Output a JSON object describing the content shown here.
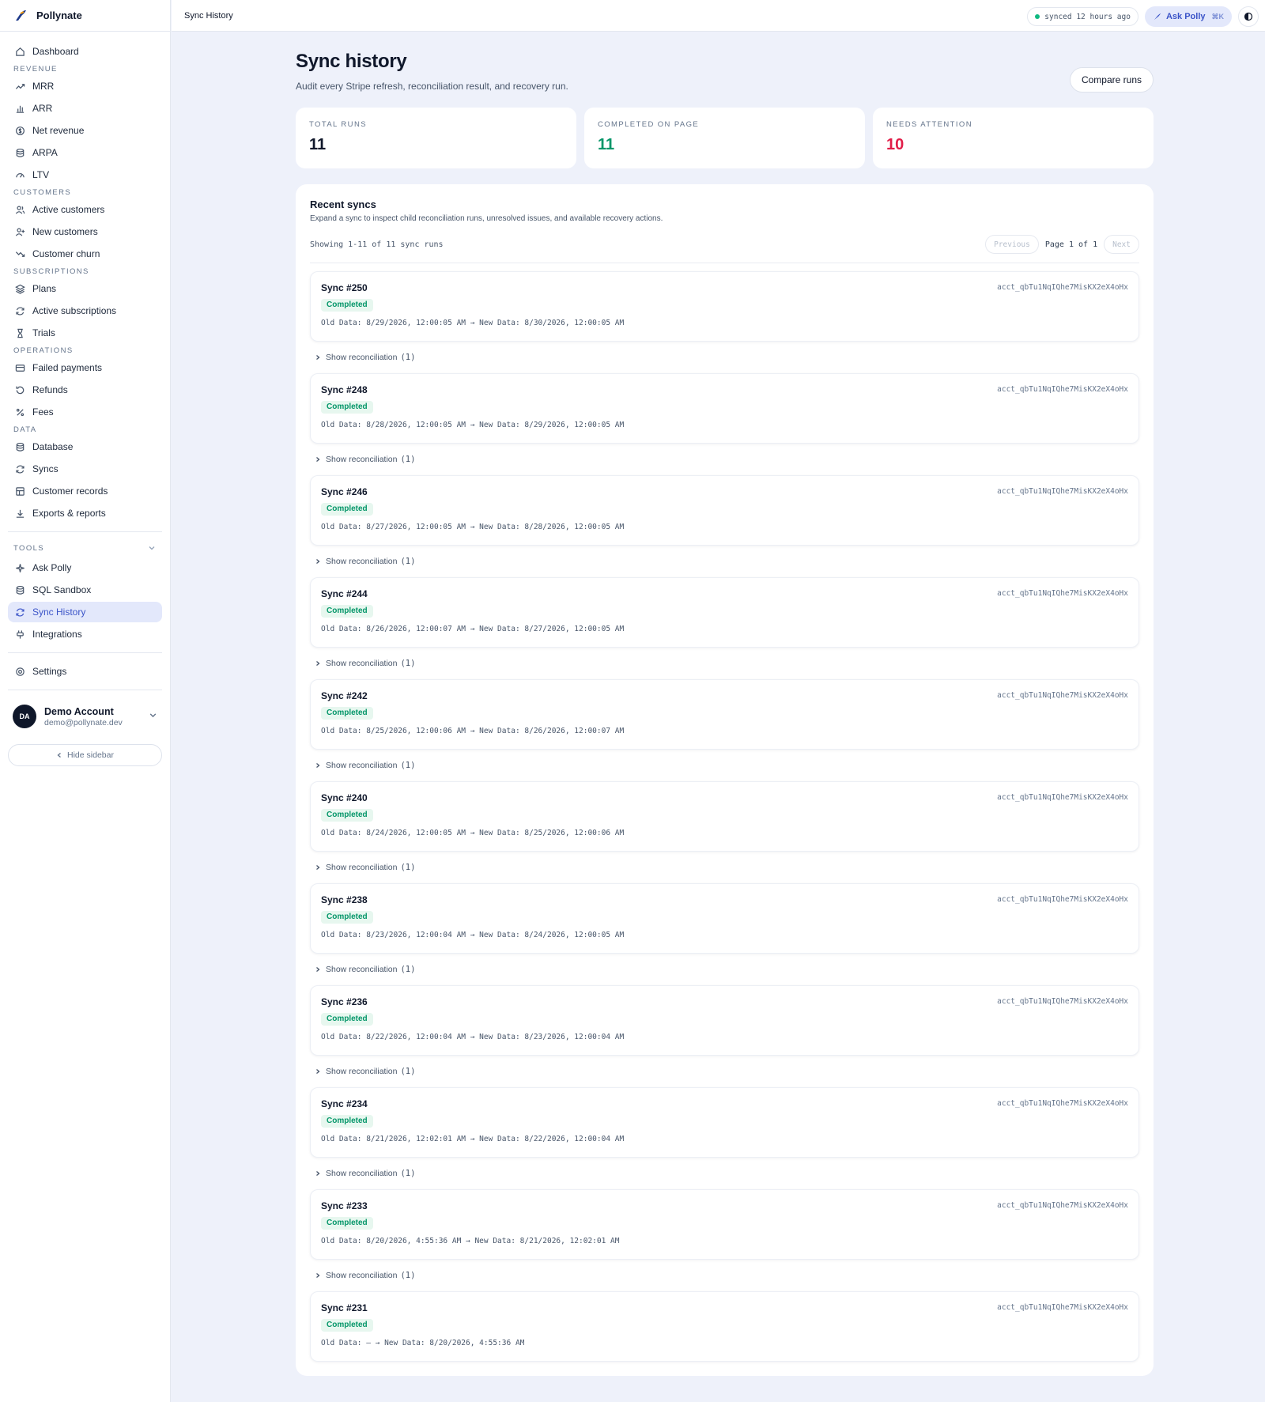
{
  "app": {
    "name": "Pollynate"
  },
  "sidebar": {
    "dashboard": "Dashboard",
    "sections": [
      {
        "label": "REVENUE",
        "items": [
          {
            "label": "MRR",
            "icon": "trend-up-icon"
          },
          {
            "label": "ARR",
            "icon": "bar-chart-icon"
          },
          {
            "label": "Net revenue",
            "icon": "dollar-circle-icon"
          },
          {
            "label": "ARPA",
            "icon": "database-icon"
          },
          {
            "label": "LTV",
            "icon": "gauge-icon"
          }
        ]
      },
      {
        "label": "CUSTOMERS",
        "items": [
          {
            "label": "Active customers",
            "icon": "users-icon"
          },
          {
            "label": "New customers",
            "icon": "user-plus-icon"
          },
          {
            "label": "Customer churn",
            "icon": "trend-down-icon"
          }
        ]
      },
      {
        "label": "SUBSCRIPTIONS",
        "items": [
          {
            "label": "Plans",
            "icon": "layers-icon"
          },
          {
            "label": "Active subscriptions",
            "icon": "refresh-icon"
          },
          {
            "label": "Trials",
            "icon": "hourglass-icon"
          }
        ]
      },
      {
        "label": "OPERATIONS",
        "items": [
          {
            "label": "Failed payments",
            "icon": "credit-card-icon"
          },
          {
            "label": "Refunds",
            "icon": "rotate-ccw-icon"
          },
          {
            "label": "Fees",
            "icon": "percent-icon"
          }
        ]
      },
      {
        "label": "DATA",
        "items": [
          {
            "label": "Database",
            "icon": "database-icon"
          },
          {
            "label": "Syncs",
            "icon": "refresh-icon"
          },
          {
            "label": "Customer records",
            "icon": "table-icon"
          },
          {
            "label": "Exports & reports",
            "icon": "download-icon"
          }
        ]
      }
    ],
    "tools_label": "TOOLS",
    "tools": [
      {
        "label": "Ask Polly",
        "icon": "sparkle-icon",
        "active": false
      },
      {
        "label": "SQL Sandbox",
        "icon": "database-icon",
        "active": false
      },
      {
        "label": "Sync History",
        "icon": "refresh-icon",
        "active": true
      },
      {
        "label": "Integrations",
        "icon": "plug-icon",
        "active": false
      }
    ],
    "settings": "Settings",
    "account": {
      "initials": "DA",
      "name": "Demo Account",
      "email": "demo@pollynate.dev"
    },
    "hide_sidebar": "Hide sidebar"
  },
  "topbar": {
    "breadcrumb": "Sync History",
    "sync_status": "synced 12 hours ago",
    "ask_polly": "Ask Polly",
    "shortcut": "⌘K"
  },
  "page": {
    "title": "Sync history",
    "subtitle": "Audit every Stripe refresh, reconciliation result, and recovery run.",
    "compare_button": "Compare runs"
  },
  "stats": [
    {
      "label": "TOTAL RUNS",
      "value": "11",
      "color": "#0f172a"
    },
    {
      "label": "COMPLETED ON PAGE",
      "value": "11",
      "color": "#059669"
    },
    {
      "label": "NEEDS ATTENTION",
      "value": "10",
      "color": "#e11d48"
    }
  ],
  "recent": {
    "title": "Recent syncs",
    "subtitle": "Expand a sync to inspect child reconciliation runs, unresolved issues, and available recovery actions.",
    "showing": "Showing 1-11 of 11 sync runs",
    "pager": {
      "previous": "Previous",
      "page_info": "Page 1 of 1",
      "next": "Next"
    },
    "show_reconciliation": "Show reconciliation",
    "syncs": [
      {
        "title": "Sync #250",
        "status": "Completed",
        "range": "Old Data: 8/29/2026, 12:00:05 AM → New Data: 8/30/2026, 12:00:05 AM",
        "account": "acct_qbTu1NqIQhe7MisKX2eX4oHx",
        "recon_count": "(1)"
      },
      {
        "title": "Sync #248",
        "status": "Completed",
        "range": "Old Data: 8/28/2026, 12:00:05 AM → New Data: 8/29/2026, 12:00:05 AM",
        "account": "acct_qbTu1NqIQhe7MisKX2eX4oHx",
        "recon_count": "(1)"
      },
      {
        "title": "Sync #246",
        "status": "Completed",
        "range": "Old Data: 8/27/2026, 12:00:05 AM → New Data: 8/28/2026, 12:00:05 AM",
        "account": "acct_qbTu1NqIQhe7MisKX2eX4oHx",
        "recon_count": "(1)"
      },
      {
        "title": "Sync #244",
        "status": "Completed",
        "range": "Old Data: 8/26/2026, 12:00:07 AM → New Data: 8/27/2026, 12:00:05 AM",
        "account": "acct_qbTu1NqIQhe7MisKX2eX4oHx",
        "recon_count": "(1)"
      },
      {
        "title": "Sync #242",
        "status": "Completed",
        "range": "Old Data: 8/25/2026, 12:00:06 AM → New Data: 8/26/2026, 12:00:07 AM",
        "account": "acct_qbTu1NqIQhe7MisKX2eX4oHx",
        "recon_count": "(1)"
      },
      {
        "title": "Sync #240",
        "status": "Completed",
        "range": "Old Data: 8/24/2026, 12:00:05 AM → New Data: 8/25/2026, 12:00:06 AM",
        "account": "acct_qbTu1NqIQhe7MisKX2eX4oHx",
        "recon_count": "(1)"
      },
      {
        "title": "Sync #238",
        "status": "Completed",
        "range": "Old Data: 8/23/2026, 12:00:04 AM → New Data: 8/24/2026, 12:00:05 AM",
        "account": "acct_qbTu1NqIQhe7MisKX2eX4oHx",
        "recon_count": "(1)"
      },
      {
        "title": "Sync #236",
        "status": "Completed",
        "range": "Old Data: 8/22/2026, 12:00:04 AM → New Data: 8/23/2026, 12:00:04 AM",
        "account": "acct_qbTu1NqIQhe7MisKX2eX4oHx",
        "recon_count": "(1)"
      },
      {
        "title": "Sync #234",
        "status": "Completed",
        "range": "Old Data: 8/21/2026, 12:02:01 AM → New Data: 8/22/2026, 12:00:04 AM",
        "account": "acct_qbTu1NqIQhe7MisKX2eX4oHx",
        "recon_count": "(1)"
      },
      {
        "title": "Sync #233",
        "status": "Completed",
        "range": "Old Data: 8/20/2026, 4:55:36 AM → New Data: 8/21/2026, 12:02:01 AM",
        "account": "acct_qbTu1NqIQhe7MisKX2eX4oHx",
        "recon_count": "(1)"
      },
      {
        "title": "Sync #231",
        "status": "Completed",
        "range": "Old Data: — → New Data: 8/20/2026, 4:55:36 AM",
        "account": "acct_qbTu1NqIQhe7MisKX2eX4oHx",
        "recon_count": ""
      }
    ]
  }
}
